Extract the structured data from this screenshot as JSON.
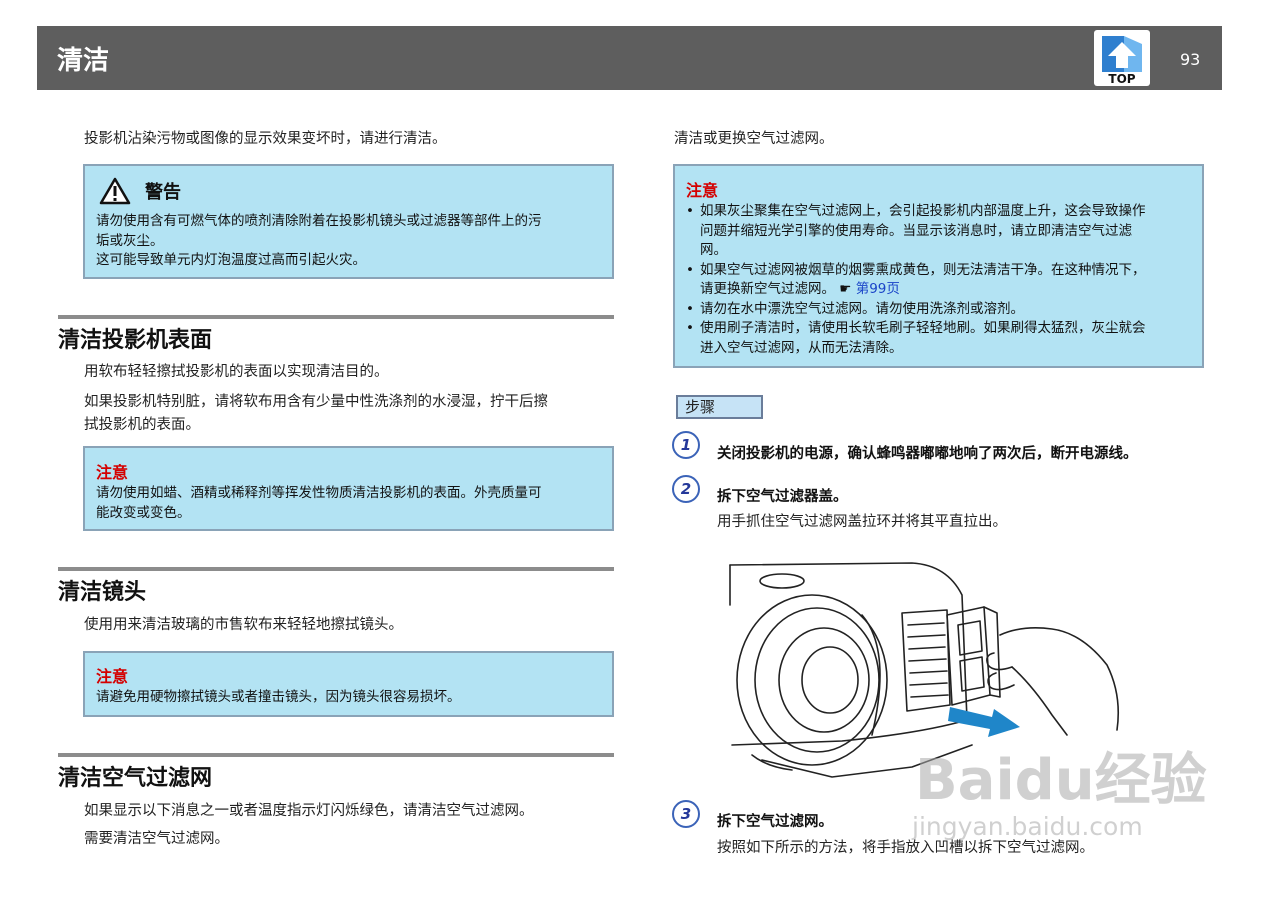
{
  "header": {
    "title": "清洁",
    "top_label": "TOP",
    "page_number": "93"
  },
  "left": {
    "intro": "投影机沾染污物或图像的显示效果变坏时，请进行清洁。",
    "warning": {
      "title": "警告",
      "line1": "请勿使用含有可燃气体的喷剂清除附着在投影机镜头或过滤器等部件上的污",
      "line2": "垢或灰尘。",
      "line3": "这可能导致单元内灯泡温度过高而引起火灾。"
    },
    "section1": {
      "title": "清洁投影机表面",
      "p1": "用软布轻轻擦拭投影机的表面以实现清洁目的。",
      "p2_line1": "如果投影机特别脏，请将软布用含有少量中性洗涤剂的水浸湿，拧干后擦",
      "p2_line2": "拭投影机的表面。",
      "notice_title": "注意",
      "notice_line1": "请勿使用如蜡、酒精或稀释剂等挥发性物质清洁投影机的表面。外壳质量可",
      "notice_line2": "能改变或变色。"
    },
    "section2": {
      "title": "清洁镜头",
      "p1": "使用用来清洁玻璃的市售软布来轻轻地擦拭镜头。",
      "notice_title": "注意",
      "notice_line1": "请避免用硬物擦拭镜头或者撞击镜头，因为镜头很容易损坏。"
    },
    "section3": {
      "title": "清洁空气过滤网",
      "p1": "如果显示以下消息之一或者温度指示灯闪烁绿色，请清洁空气过滤网。",
      "p2": "需要清洁空气过滤网。"
    }
  },
  "right": {
    "intro": "清洁或更换空气过滤网。",
    "notice": {
      "title": "注意",
      "b1_line1": "如果灰尘聚集在空气过滤网上，会引起投影机内部温度上升，这会导致操作",
      "b1_line2": "问题并缩短光学引擎的使用寿命。当显示该消息时，请立即清洁空气过滤",
      "b1_line3": "网。",
      "b2_line1": "如果空气过滤网被烟草的烟雾熏成黄色，则无法清洁干净。在这种情况下，",
      "b2_line2": "请更换新空气过滤网。",
      "b2_link": "第99页",
      "b3": "请勿在水中漂洗空气过滤网。请勿使用洗涤剂或溶剂。",
      "b4_line1": "使用刷子清洁时，请使用长软毛刷子轻轻地刷。如果刷得太猛烈，灰尘就会",
      "b4_line2": "进入空气过滤网，从而无法清除。"
    },
    "steps_label": "步骤",
    "step1": {
      "num": "1",
      "title": "关闭投影机的电源，确认蜂鸣器嘟嘟地响了两次后，断开电源线。"
    },
    "step2": {
      "num": "2",
      "title": "拆下空气过滤器盖。",
      "desc": "用手抓住空气过滤网盖拉环并将其平直拉出。"
    },
    "step3": {
      "num": "3",
      "title": "拆下空气过滤网。",
      "desc": "按照如下所示的方法，将手指放入凹槽以拆下空气过滤网。"
    }
  },
  "watermark": {
    "brand": "Baidu经验",
    "url": "jingyan.baidu.com"
  },
  "colors": {
    "header_bg": "#5e5e5e",
    "notice_bg": "#b3e3f3",
    "notice_title": "#d40000",
    "link": "#1a44c8"
  }
}
